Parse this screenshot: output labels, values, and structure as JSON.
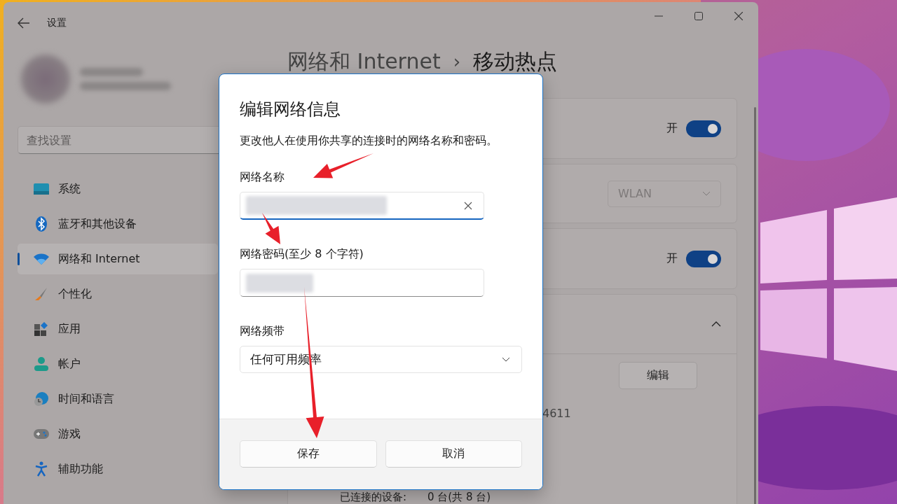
{
  "window": {
    "title": "设置"
  },
  "sidebar": {
    "search": {
      "placeholder": "查找设置"
    },
    "items": [
      {
        "label": "系统",
        "selected": false
      },
      {
        "label": "蓝牙和其他设备",
        "selected": false
      },
      {
        "label": "网络和 Internet",
        "selected": true
      },
      {
        "label": "个性化",
        "selected": false
      },
      {
        "label": "应用",
        "selected": false
      },
      {
        "label": "帐户",
        "selected": false
      },
      {
        "label": "时间和语言",
        "selected": false
      },
      {
        "label": "游戏",
        "selected": false
      },
      {
        "label": "辅助功能",
        "selected": false
      }
    ]
  },
  "header": {
    "parent": "网络和 Internet",
    "separator": "›",
    "current": "移动热点"
  },
  "cards": [
    {
      "kind": "toggle",
      "state_label": "开",
      "on": true
    },
    {
      "kind": "dropdown",
      "value": "WLAN",
      "disabled": true
    },
    {
      "kind": "toggle",
      "state_label": "开",
      "on": true
    },
    {
      "kind": "expander",
      "expanded": true,
      "edit_button": "编辑",
      "partial_value": "4611",
      "connected_label": "已连接的设备:",
      "connected_value": "0 台(共 8 台)"
    }
  ],
  "dialog": {
    "title": "编辑网络信息",
    "description": "更改他人在使用你共享的连接时的网络名称和密码。",
    "fields": [
      {
        "kind": "text",
        "label": "网络名称",
        "focused": true
      },
      {
        "kind": "text",
        "label": "网络密码(至少 8 个字符)",
        "focused": false
      },
      {
        "kind": "select",
        "label": "网络频带",
        "value": "任何可用频率"
      }
    ],
    "buttons": [
      "保存",
      "取消"
    ]
  }
}
